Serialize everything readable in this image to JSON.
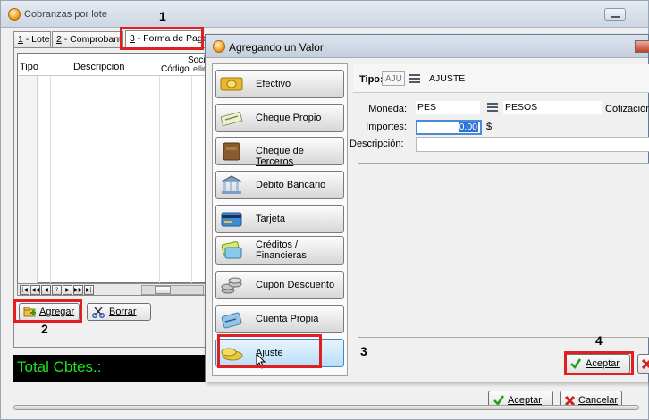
{
  "main_window": {
    "title": "Cobranzas por lote",
    "tabs": [
      {
        "num": "1",
        "label": " - Lote"
      },
      {
        "num": "2",
        "label": " - Comprobantes"
      },
      {
        "num": "3",
        "label": " - Forma de Pago"
      }
    ],
    "grid": {
      "col_tipo": "Tipo",
      "col_descripcion": "Descripcion",
      "col_socio": "Socio",
      "col_codigo": "Código",
      "col_apellido": "ellid"
    },
    "navigator": [
      "|◀",
      "◀◀",
      "◀",
      "?",
      "▶",
      "▶▶",
      "▶|"
    ],
    "agregar_label": "Agregar",
    "borrar_label": "Borrar",
    "total_label": "Total Cbtes.:",
    "aceptar_label": "Aceptar",
    "cancelar_label": "Cancelar"
  },
  "dialog": {
    "title": "Agregando un Valor",
    "methods": [
      {
        "label": "Efectivo",
        "icon": "cash-icon"
      },
      {
        "label": "Cheque Propio",
        "icon": "check-icon"
      },
      {
        "label": "Cheque de Terceros",
        "icon": "wallet-icon"
      },
      {
        "label": "Debito Bancario",
        "icon": "bank-icon"
      },
      {
        "label": "Tarjeta",
        "icon": "credit-card-icon"
      },
      {
        "label": "Créditos /",
        "label2": "Financieras",
        "icon": "cards-icon"
      },
      {
        "label": "Cupón Descuento",
        "icon": "coins-stack-icon"
      },
      {
        "label": "Cuenta Propia",
        "icon": "bank-card-icon"
      },
      {
        "label": "Ajuste",
        "icon": "coins-icon"
      }
    ],
    "tipo_label": "Tipo:",
    "tipo_code": "AJU",
    "tipo_desc": "AJUSTE",
    "moneda_label": "Moneda:",
    "moneda_code": "PES",
    "moneda_desc": "PESOS",
    "cotizacion_label": "Cotización",
    "importes_label": "Importes:",
    "importes_value": "0.00",
    "currency_symbol": "$",
    "descripcion_label": "Descripción:",
    "aceptar_label": "Aceptar"
  },
  "annotations": [
    "1",
    "2",
    "3",
    "4"
  ],
  "colors": {
    "annotation": "#e02020",
    "total_text": "#20e020",
    "selection": "#3073d8"
  }
}
